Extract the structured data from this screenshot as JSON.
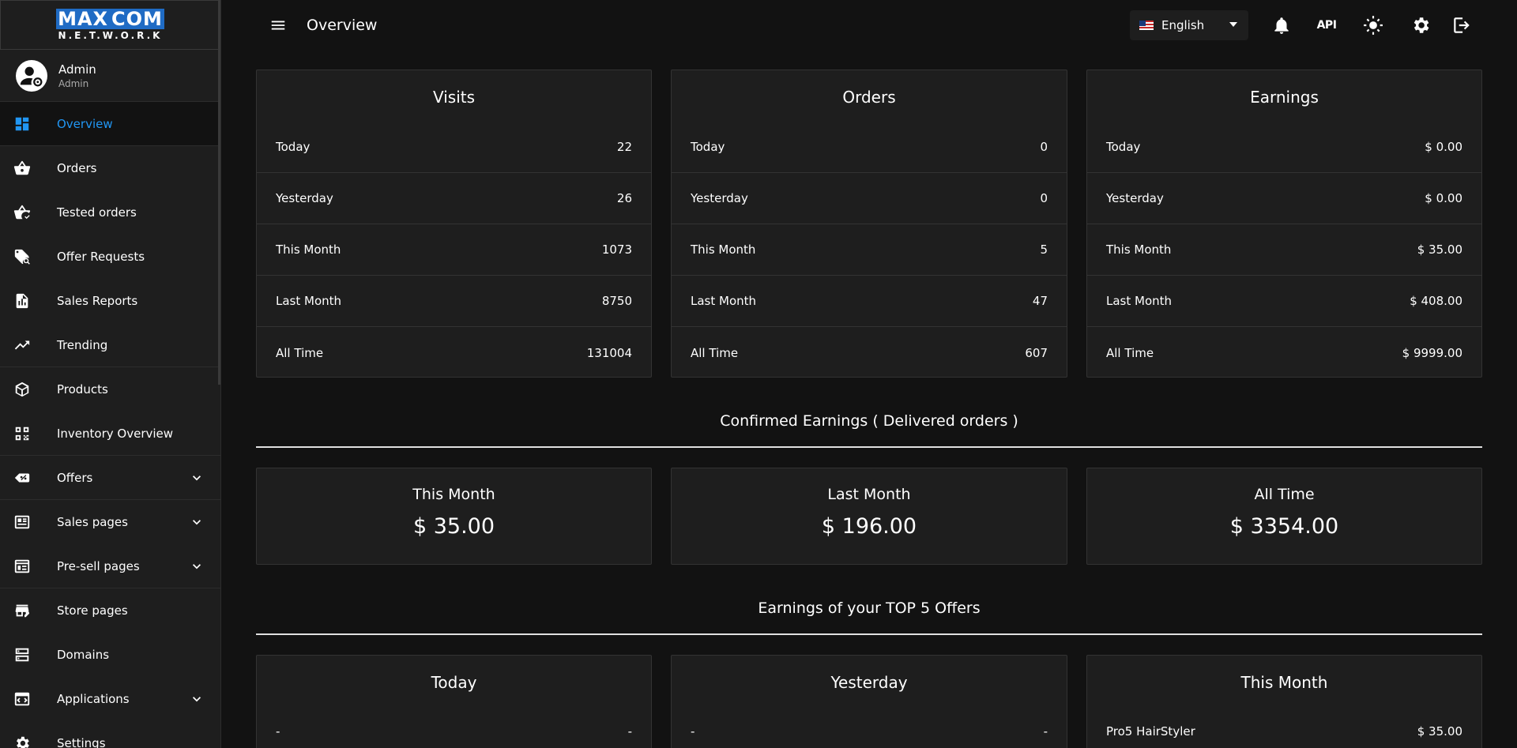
{
  "brand": {
    "logo_top_left": "MAX",
    "logo_top_right": "COM",
    "logo_sub": "N.E.T.W.O.R.K"
  },
  "user": {
    "name": "Admin",
    "role": "Admin"
  },
  "sidebar": {
    "items": [
      {
        "label": "Overview",
        "icon": "dashboard-icon"
      },
      {
        "label": "Orders",
        "icon": "basket-icon"
      },
      {
        "label": "Tested orders",
        "icon": "basket-check-icon"
      },
      {
        "label": "Offer Requests",
        "icon": "tag-search-icon"
      },
      {
        "label": "Sales Reports",
        "icon": "report-icon"
      },
      {
        "label": "Trending",
        "icon": "trending-up-icon"
      },
      {
        "label": "Products",
        "icon": "box-icon"
      },
      {
        "label": "Inventory Overview",
        "icon": "qr-code-icon"
      },
      {
        "label": "Offers",
        "icon": "discount-tag-icon"
      },
      {
        "label": "Sales pages",
        "icon": "newspaper-icon"
      },
      {
        "label": "Pre-sell pages",
        "icon": "web-layout-icon"
      },
      {
        "label": "Store pages",
        "icon": "store-edit-icon"
      },
      {
        "label": "Domains",
        "icon": "server-icon"
      },
      {
        "label": "Applications",
        "icon": "code-window-icon"
      },
      {
        "label": "Settings",
        "icon": "settings-icon"
      }
    ]
  },
  "topbar": {
    "title": "Overview",
    "language": "English",
    "api_label": "API"
  },
  "stats": {
    "visits": {
      "title": "Visits",
      "rows": [
        {
          "label": "Today",
          "value": "22"
        },
        {
          "label": "Yesterday",
          "value": "26"
        },
        {
          "label": "This Month",
          "value": "1073"
        },
        {
          "label": "Last Month",
          "value": "8750"
        },
        {
          "label": "All Time",
          "value": "131004"
        }
      ]
    },
    "orders": {
      "title": "Orders",
      "rows": [
        {
          "label": "Today",
          "value": "0"
        },
        {
          "label": "Yesterday",
          "value": "0"
        },
        {
          "label": "This Month",
          "value": "5"
        },
        {
          "label": "Last Month",
          "value": "47"
        },
        {
          "label": "All Time",
          "value": "607"
        }
      ]
    },
    "earnings": {
      "title": "Earnings",
      "rows": [
        {
          "label": "Today",
          "value": "$ 0.00"
        },
        {
          "label": "Yesterday",
          "value": "$ 0.00"
        },
        {
          "label": "This Month",
          "value": "$ 35.00"
        },
        {
          "label": "Last Month",
          "value": "$ 408.00"
        },
        {
          "label": "All Time",
          "value": "$ 9999.00"
        }
      ]
    }
  },
  "confirmed": {
    "title": "Confirmed Earnings ( Delivered orders )",
    "cards": [
      {
        "label": "This Month",
        "value": "$ 35.00"
      },
      {
        "label": "Last Month",
        "value": "$ 196.00"
      },
      {
        "label": "All Time",
        "value": "$ 3354.00"
      }
    ]
  },
  "top5": {
    "title": "Earnings of your TOP 5 Offers",
    "cards": [
      {
        "label": "Today",
        "name": "-",
        "value": "-"
      },
      {
        "label": "Yesterday",
        "name": "-",
        "value": "-"
      },
      {
        "label": "This Month",
        "name": "Pro5 HairStyler",
        "value": "$ 35.00"
      }
    ]
  }
}
